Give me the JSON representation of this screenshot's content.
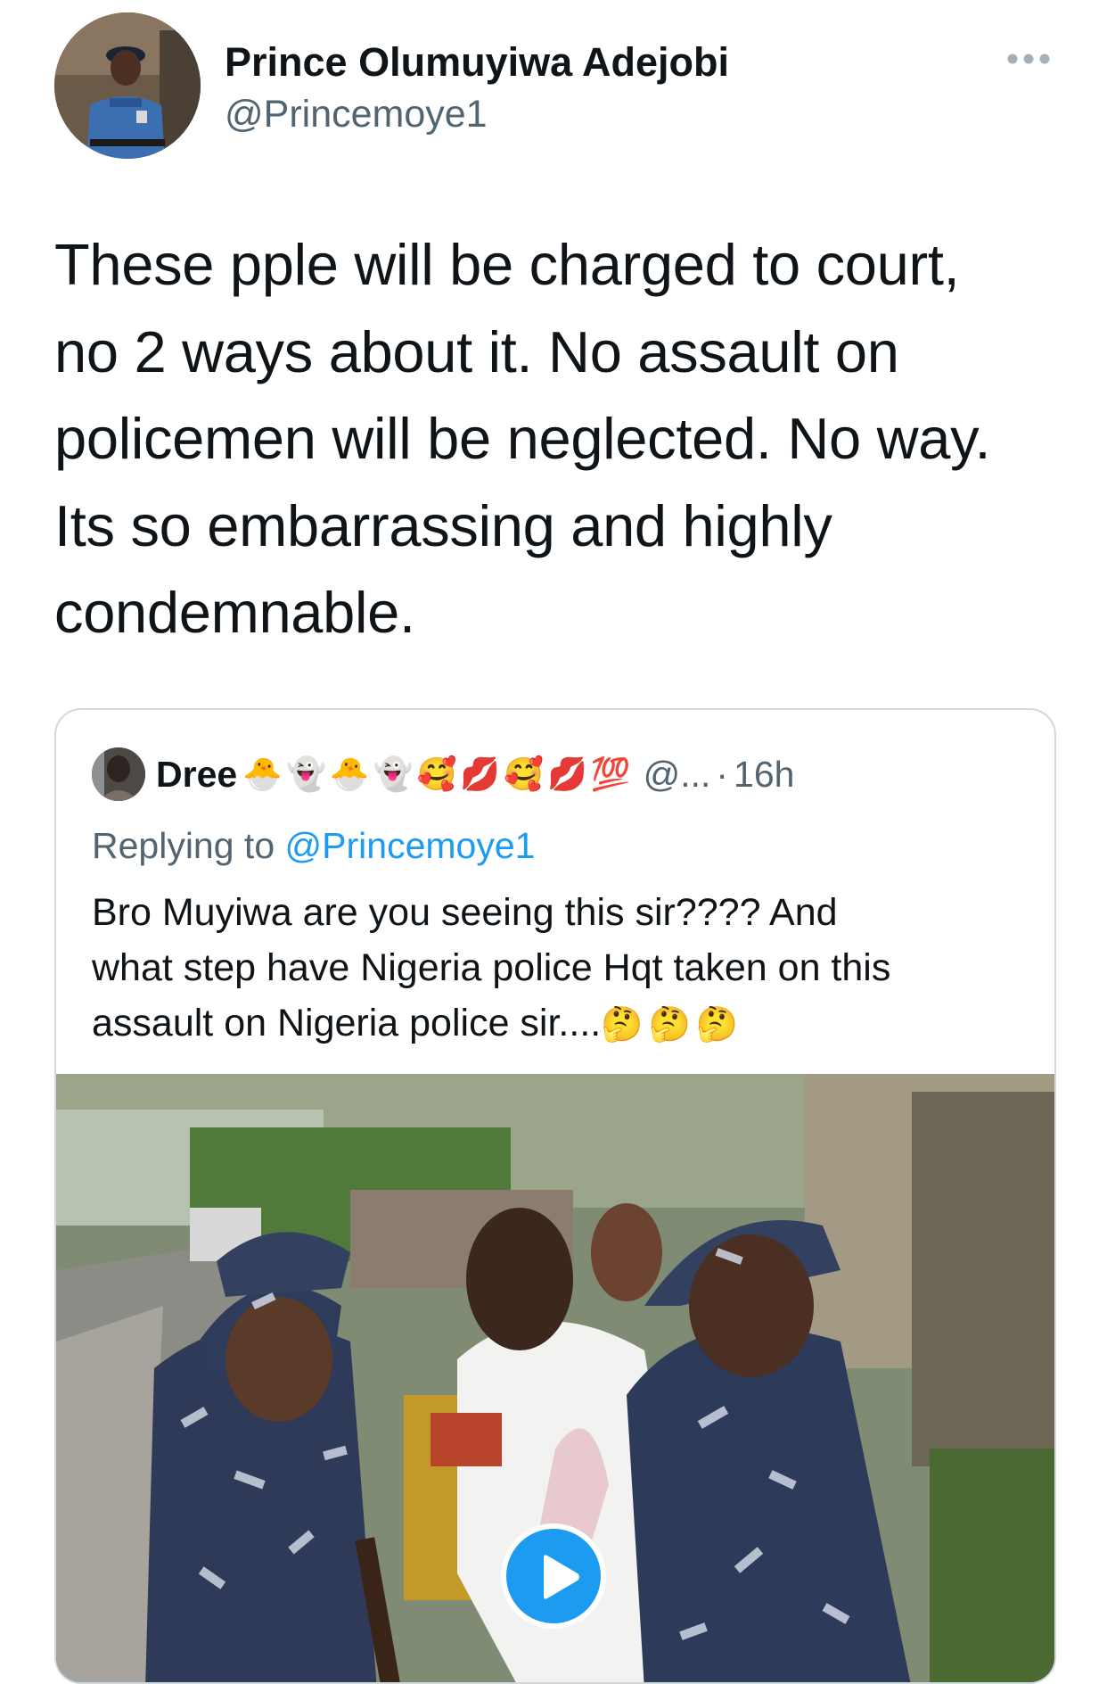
{
  "tweet": {
    "author": {
      "name": "Prince Olumuyiwa Adejobi",
      "handle": "@Princemoye1"
    },
    "text_lines": [
      "These pple will be charged to court,",
      "no 2 ways about it. No assault on",
      "policemen will be neglected.  No way.",
      "Its so embarrassing and highly",
      "condemnable."
    ]
  },
  "quote": {
    "author": {
      "name": "Dree",
      "emojis": "🐣👻🐣👻🥰💋🥰💋💯",
      "handle": "@...",
      "separator": "·",
      "time": "16h"
    },
    "replying_prefix": "Replying to",
    "replying_to": "@Princemoye1",
    "text_lines": [
      "Bro Muyiwa are you seeing this sir???? And",
      "what step have Nigeria police Hqt taken on this",
      "assault on Nigeria police sir...."
    ],
    "text_tail_emojis": "🤔🤔🤔"
  },
  "colors": {
    "text_primary": "#0f1419",
    "text_secondary": "#536471",
    "link": "#1d9bf0",
    "border": "#cfd9de"
  },
  "icons": {
    "more": "more-dots-icon",
    "play": "play-icon"
  }
}
